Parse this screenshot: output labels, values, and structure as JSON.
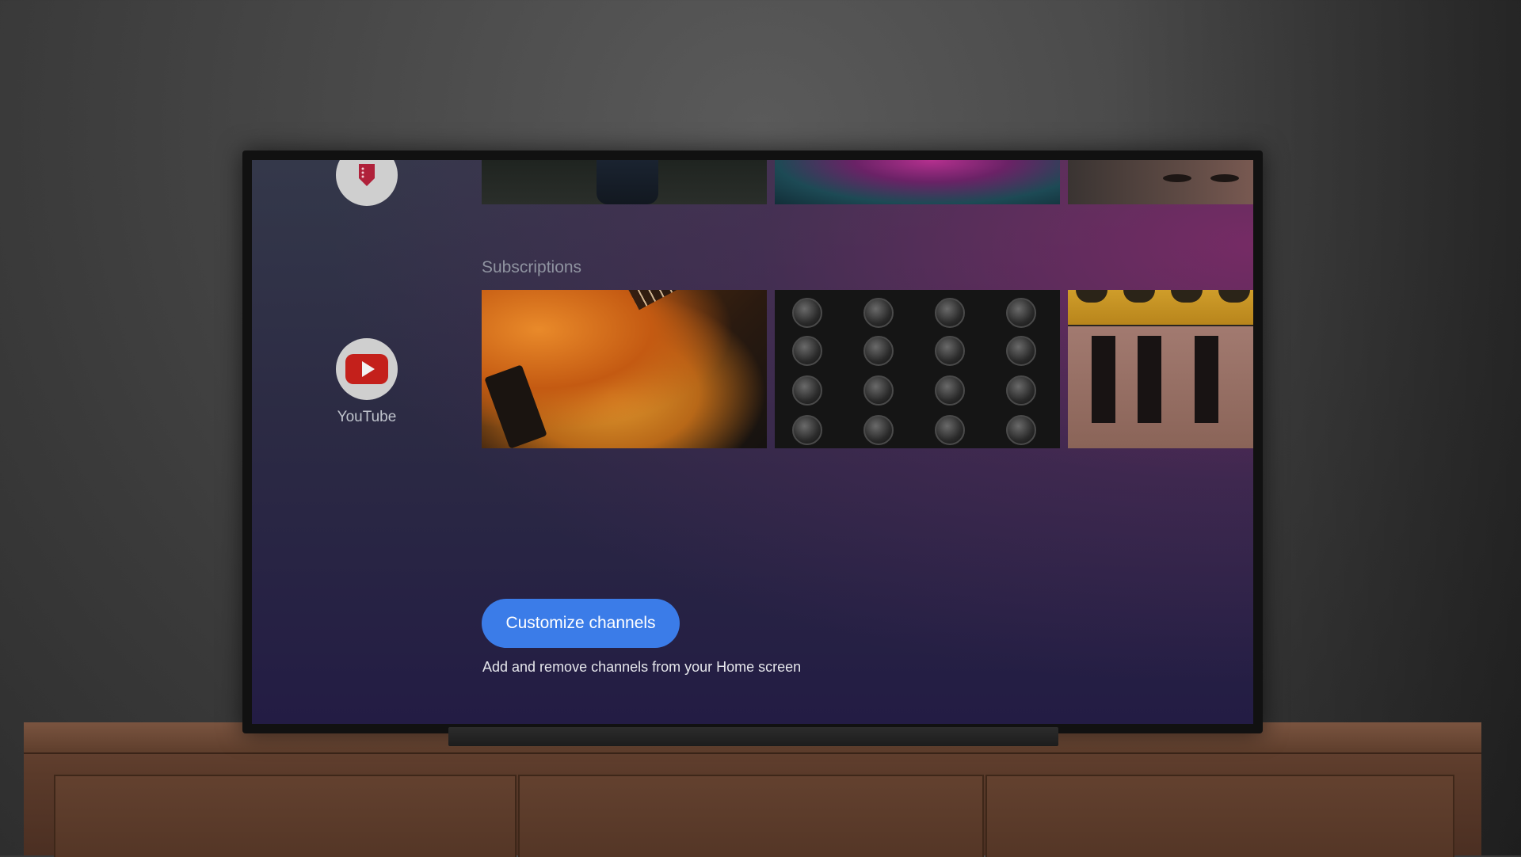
{
  "home_screen": {
    "apps": [
      {
        "name": "Play Movies & TV",
        "icon": "play-movies-icon",
        "label": ""
      },
      {
        "name": "YouTube",
        "icon": "youtube-icon",
        "label": "YouTube"
      }
    ],
    "sections": [
      {
        "title": "Subscriptions"
      }
    ],
    "customize": {
      "button_label": "Customize channels",
      "hint": "Add and remove channels from your Home screen"
    }
  },
  "colors": {
    "accent": "#3b7ce8",
    "youtube_red": "#c4201b"
  }
}
